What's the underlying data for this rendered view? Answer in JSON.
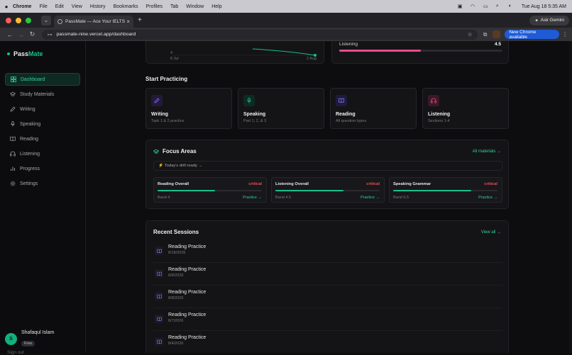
{
  "mac_menu": {
    "app": "Chrome",
    "items": [
      "File",
      "Edit",
      "View",
      "History",
      "Bookmarks",
      "Profiles",
      "Tab",
      "Window",
      "Help"
    ],
    "clock": "Tue Aug 18  5:35 AM"
  },
  "browser": {
    "tab_title": "PassMate — Ace Your IELTS ○",
    "url": "passmate-nine.vercel.app/dashboard",
    "ask_gemini": "Ask Gemini",
    "new_chrome": "New Chrome available"
  },
  "brand": {
    "name_a": "Pass",
    "name_b": "Mate"
  },
  "sidebar": {
    "items": [
      {
        "label": "Dashboard",
        "icon": "grid-icon"
      },
      {
        "label": "Study Materials",
        "icon": "graduation-cap-icon"
      },
      {
        "label": "Writing",
        "icon": "pen-icon"
      },
      {
        "label": "Speaking",
        "icon": "mic-icon"
      },
      {
        "label": "Reading",
        "icon": "book-icon"
      },
      {
        "label": "Listening",
        "icon": "headphones-icon"
      },
      {
        "label": "Progress",
        "icon": "chart-icon"
      },
      {
        "label": "Settings",
        "icon": "gear-icon"
      }
    ]
  },
  "user": {
    "initial": "S",
    "name": "Shafaqul Islam",
    "plan": "Free",
    "signout": "Sign out"
  },
  "top": {
    "axis_left": "8 Jul",
    "axis_right": "2 Aug",
    "axis_val": "4",
    "listening_label": "Listening",
    "listening_value": "4.5",
    "listening_fill": 0.5
  },
  "start": {
    "title": "Start Practicing",
    "cards": [
      {
        "title": "Writing",
        "sub": "Task 1 & 2 practice",
        "color": "#8b6cf0",
        "icon": "pen-icon"
      },
      {
        "title": "Speaking",
        "sub": "Part 1, 2, & 3",
        "color": "#18c48e",
        "icon": "mic-icon"
      },
      {
        "title": "Reading",
        "sub": "All question types",
        "color": "#7b6df2",
        "icon": "book-icon"
      },
      {
        "title": "Listening",
        "sub": "Sections 1-4",
        "color": "#ef4b7b",
        "icon": "headphones-icon"
      }
    ]
  },
  "focus": {
    "title": "Focus Areas",
    "all": "All materials →",
    "drill": "⚡ Today's drill ready →",
    "areas": [
      {
        "name": "Reading Overall",
        "level": "critical",
        "band": "Band 4",
        "action": "Practice →",
        "fill": 0.55
      },
      {
        "name": "Listening Overall",
        "level": "critical",
        "band": "Band 4.5",
        "action": "Practice →",
        "fill": 0.65
      },
      {
        "name": "Speaking Grammar",
        "level": "critical",
        "band": "Band 5.5",
        "action": "Practice →",
        "fill": 0.75
      }
    ]
  },
  "recent": {
    "title": "Recent Sessions",
    "view_all": "View all →",
    "sessions": [
      {
        "name": "Reading Practice",
        "date": "8/18/2026"
      },
      {
        "name": "Reading Practice",
        "date": "8/8/2026"
      },
      {
        "name": "Reading Practice",
        "date": "8/8/2026"
      },
      {
        "name": "Reading Practice",
        "date": "8/7/2026"
      },
      {
        "name": "Reading Practice",
        "date": "8/4/2026"
      }
    ]
  }
}
